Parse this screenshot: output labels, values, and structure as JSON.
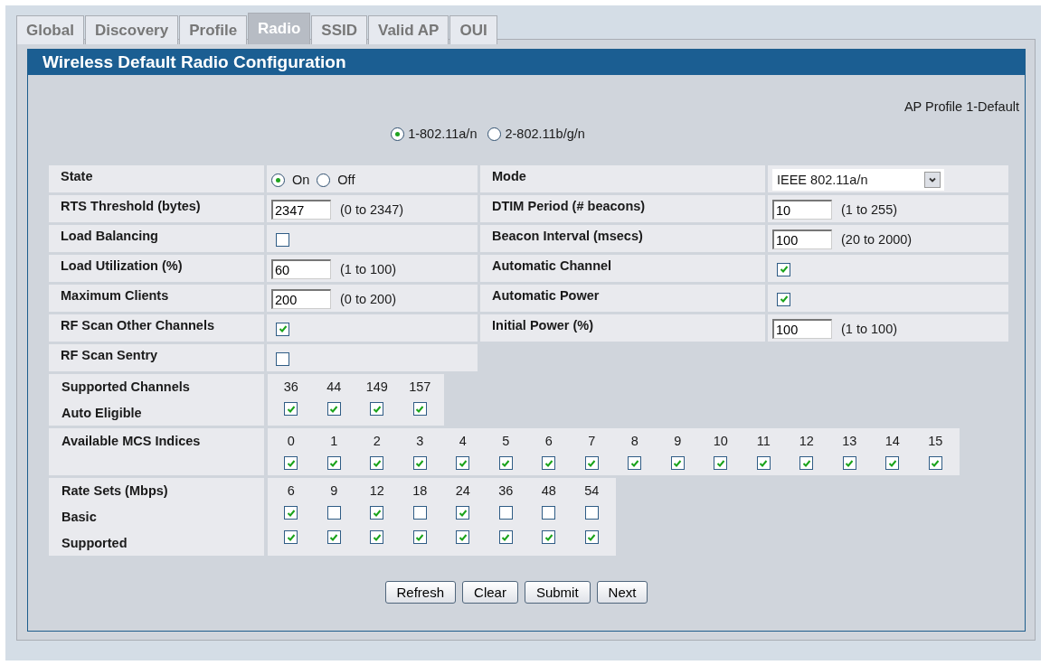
{
  "tabs": [
    {
      "label": "Global",
      "selected": false
    },
    {
      "label": "Discovery",
      "selected": false
    },
    {
      "label": "Profile",
      "selected": false
    },
    {
      "label": "Radio",
      "selected": true
    },
    {
      "label": "SSID",
      "selected": false
    },
    {
      "label": "Valid AP",
      "selected": false
    },
    {
      "label": "OUI",
      "selected": false
    }
  ],
  "panel": {
    "title": "Wireless Default Radio Configuration",
    "profile": "AP Profile 1-Default",
    "radios": [
      {
        "label": "1-802.11a/n",
        "selected": true
      },
      {
        "label": "2-802.11b/g/n",
        "selected": false
      }
    ],
    "left_rows": [
      {
        "label": "State",
        "kind": "radio",
        "options": [
          {
            "label": "On",
            "selected": true
          },
          {
            "label": "Off",
            "selected": false
          }
        ]
      },
      {
        "label": "RTS Threshold (bytes)",
        "kind": "input",
        "value": "2347",
        "range": "(0 to 2347)"
      },
      {
        "label": "Load Balancing",
        "kind": "checkbox",
        "checked": false
      },
      {
        "label": "Load Utilization (%)",
        "kind": "input",
        "value": "60",
        "range": "(1 to 100)"
      },
      {
        "label": "Maximum Clients",
        "kind": "input",
        "value": "200",
        "range": "(0 to 200)"
      },
      {
        "label": "RF Scan Other Channels",
        "kind": "checkbox",
        "checked": true
      },
      {
        "label": "RF Scan Sentry",
        "kind": "checkbox",
        "checked": false
      }
    ],
    "right_rows": [
      {
        "label": "Mode",
        "kind": "select",
        "value": "IEEE 802.11a/n"
      },
      {
        "label": "DTIM Period (# beacons)",
        "kind": "input",
        "value": "10",
        "range": "(1 to 255)"
      },
      {
        "label": "Beacon Interval (msecs)",
        "kind": "input",
        "value": "100",
        "range": "(20 to 2000)"
      },
      {
        "label": "Automatic Channel",
        "kind": "checkbox",
        "checked": true
      },
      {
        "label": "Automatic Power",
        "kind": "checkbox",
        "checked": true
      },
      {
        "label": "Initial Power (%)",
        "kind": "input",
        "value": "100",
        "range": "(1 to 100)"
      }
    ],
    "channels": {
      "label": "Supported Channels",
      "sub_label": "Auto Eligible",
      "items": [
        {
          "value": "36",
          "checked": true
        },
        {
          "value": "44",
          "checked": true
        },
        {
          "value": "149",
          "checked": true
        },
        {
          "value": "157",
          "checked": true
        }
      ]
    },
    "mcs": {
      "label": "Available MCS Indices",
      "items": [
        {
          "value": "0",
          "checked": true
        },
        {
          "value": "1",
          "checked": true
        },
        {
          "value": "2",
          "checked": true
        },
        {
          "value": "3",
          "checked": true
        },
        {
          "value": "4",
          "checked": true
        },
        {
          "value": "5",
          "checked": true
        },
        {
          "value": "6",
          "checked": true
        },
        {
          "value": "7",
          "checked": true
        },
        {
          "value": "8",
          "checked": true
        },
        {
          "value": "9",
          "checked": true
        },
        {
          "value": "10",
          "checked": true
        },
        {
          "value": "11",
          "checked": true
        },
        {
          "value": "12",
          "checked": true
        },
        {
          "value": "13",
          "checked": true
        },
        {
          "value": "14",
          "checked": true
        },
        {
          "value": "15",
          "checked": true
        }
      ]
    },
    "rates": {
      "label": "Rate Sets (Mbps)",
      "basic_label": "Basic",
      "supported_label": "Supported",
      "items": [
        {
          "value": "6",
          "basic": true,
          "supported": true
        },
        {
          "value": "9",
          "basic": false,
          "supported": true
        },
        {
          "value": "12",
          "basic": true,
          "supported": true
        },
        {
          "value": "18",
          "basic": false,
          "supported": true
        },
        {
          "value": "24",
          "basic": true,
          "supported": true
        },
        {
          "value": "36",
          "basic": false,
          "supported": true
        },
        {
          "value": "48",
          "basic": false,
          "supported": true
        },
        {
          "value": "54",
          "basic": false,
          "supported": true
        }
      ]
    },
    "buttons": [
      "Refresh",
      "Clear",
      "Submit",
      "Next"
    ]
  }
}
